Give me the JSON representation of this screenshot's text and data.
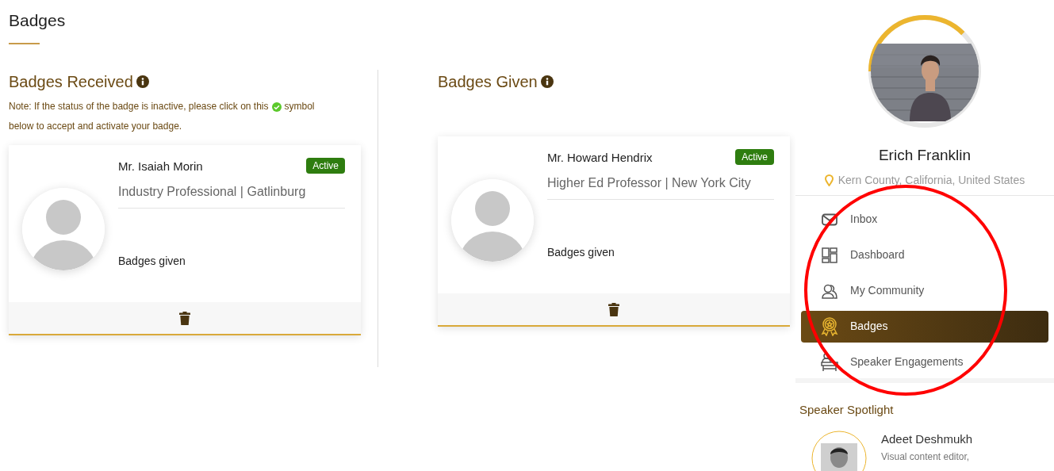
{
  "page_title": "Badges",
  "received": {
    "title": "Badges Received",
    "note_before": "Note: If the status of the badge is inactive, please click on this",
    "note_after": "symbol",
    "note_line2": "below to accept and activate your badge.",
    "cards": [
      {
        "name": "Mr. Isaiah Morin",
        "status": "Active",
        "active": true,
        "role": "Industry Professional | Gatlinburg",
        "label": "Badges given"
      }
    ]
  },
  "given": {
    "title": "Badges Given",
    "cards": [
      {
        "name": "Mr. Howard Hendrix",
        "status": "Active",
        "active": true,
        "role": "Higher Ed Professor | New York City",
        "label": "Badges given"
      }
    ]
  },
  "profile": {
    "level": 0.375,
    "name": "Erich Franklin",
    "location": "Kern County, California, United States"
  },
  "nav": [
    {
      "kind": "inbox",
      "label": "Inbox",
      "selected": false
    },
    {
      "kind": "dashboard",
      "label": "Dashboard",
      "selected": false
    },
    {
      "kind": "community",
      "label": "My Community",
      "selected": false
    },
    {
      "kind": "badges",
      "label": "Badges",
      "selected": true
    },
    {
      "kind": "speaker",
      "label": "Speaker Engagements",
      "selected": false
    }
  ],
  "spotlight": {
    "title": "Speaker Spotlight",
    "name": "Adeet Deshmukh",
    "role": "Visual content editor,"
  }
}
